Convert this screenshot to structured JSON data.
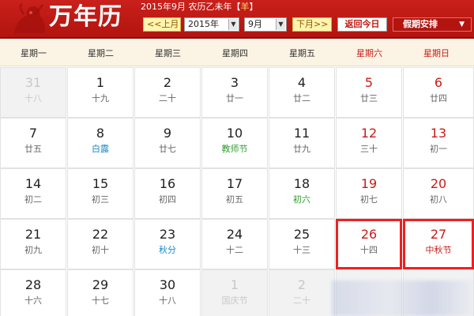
{
  "header": {
    "logo_title": "万年历",
    "date_info": "2015年9月 农历乙未年【",
    "zodiac": "羊",
    "date_info_end": "】",
    "prev_month": "<<上月",
    "year_value": "2015年",
    "month_value": "9月",
    "next_month": "下月>>",
    "today_button": "返回今日",
    "holiday_button": "假期安排"
  },
  "weekdays": [
    "星期一",
    "星期二",
    "星期三",
    "星期四",
    "星期五",
    "星期六",
    "星期日"
  ],
  "colors": {
    "header_red": "#c9201b",
    "weekend_red": "#c81c17",
    "solar_term_blue": "#1b8ac6",
    "festival_green": "#2f9b2f",
    "highlight_border": "#f02020"
  },
  "days": [
    {
      "day": "31",
      "sub": "十八",
      "other": true
    },
    {
      "day": "1",
      "sub": "十九"
    },
    {
      "day": "2",
      "sub": "二十"
    },
    {
      "day": "3",
      "sub": "廿一"
    },
    {
      "day": "4",
      "sub": "廿二"
    },
    {
      "day": "5",
      "sub": "廿三",
      "weekend": true
    },
    {
      "day": "6",
      "sub": "廿四",
      "weekend": true
    },
    {
      "day": "7",
      "sub": "廿五"
    },
    {
      "day": "8",
      "sub": "白露",
      "type": "solar"
    },
    {
      "day": "9",
      "sub": "廿七"
    },
    {
      "day": "10",
      "sub": "教师节",
      "type": "fest-green"
    },
    {
      "day": "11",
      "sub": "廿九"
    },
    {
      "day": "12",
      "sub": "三十",
      "weekend": true
    },
    {
      "day": "13",
      "sub": "初一",
      "weekend": true
    },
    {
      "day": "14",
      "sub": "初二"
    },
    {
      "day": "15",
      "sub": "初三"
    },
    {
      "day": "16",
      "sub": "初四"
    },
    {
      "day": "17",
      "sub": "初五"
    },
    {
      "day": "18",
      "sub": "初六",
      "type": "fest-green"
    },
    {
      "day": "19",
      "sub": "初七",
      "weekend": true
    },
    {
      "day": "20",
      "sub": "初八",
      "weekend": true
    },
    {
      "day": "21",
      "sub": "初九"
    },
    {
      "day": "22",
      "sub": "初十"
    },
    {
      "day": "23",
      "sub": "秋分",
      "type": "solar"
    },
    {
      "day": "24",
      "sub": "十二"
    },
    {
      "day": "25",
      "sub": "十三"
    },
    {
      "day": "26",
      "sub": "十四",
      "weekend": true,
      "highlight": true
    },
    {
      "day": "27",
      "sub": "中秋节",
      "weekend": true,
      "highlight": true,
      "type": "fest-red"
    },
    {
      "day": "28",
      "sub": "十六"
    },
    {
      "day": "29",
      "sub": "十七"
    },
    {
      "day": "30",
      "sub": "十八"
    },
    {
      "day": "1",
      "sub": "国庆节",
      "other": true,
      "type": "fest-red"
    },
    {
      "day": "2",
      "sub": "二十",
      "other": true
    },
    {
      "day": "",
      "sub": "",
      "other": true,
      "blurred": true
    },
    {
      "day": "",
      "sub": "",
      "other": true,
      "blurred": true
    }
  ]
}
